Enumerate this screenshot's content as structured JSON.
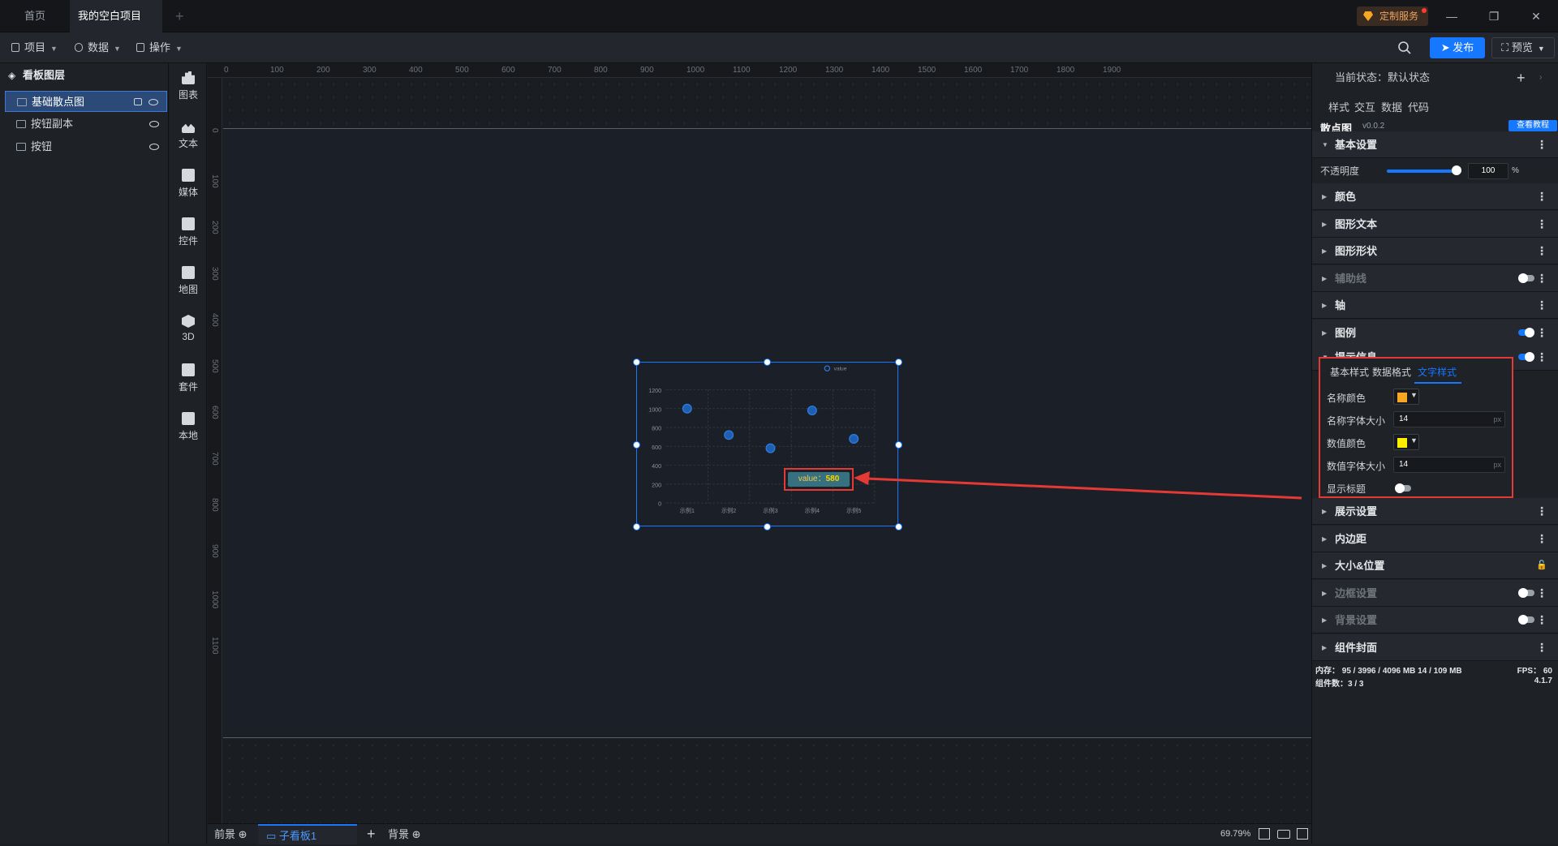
{
  "titlebar": {
    "home_tab": "首页",
    "project_tab": "我的空白项目",
    "add_tab": "+",
    "custom_service": "定制服务",
    "minimize": "—",
    "restore": "❐",
    "close": "✕"
  },
  "menubar": {
    "project": "项目",
    "data": "数据",
    "operate": "操作",
    "publish": "发布",
    "preview": "预览"
  },
  "layers": {
    "title": "看板图层",
    "items": [
      {
        "label": "基础散点图",
        "selected": true
      },
      {
        "label": "按钮副本",
        "selected": false
      },
      {
        "label": "按钮",
        "selected": false
      }
    ]
  },
  "toolbox": {
    "items": [
      {
        "label": "图表",
        "icon": "bar-chart-icon"
      },
      {
        "label": "文本",
        "icon": "text-icon"
      },
      {
        "label": "媒体",
        "icon": "media-icon"
      },
      {
        "label": "控件",
        "icon": "control-icon"
      },
      {
        "label": "地图",
        "icon": "map-icon"
      },
      {
        "label": "3D",
        "icon": "cube-icon"
      },
      {
        "label": "套件",
        "icon": "kit-icon"
      },
      {
        "label": "本地",
        "icon": "puzzle-icon"
      }
    ]
  },
  "ruler": {
    "top": [
      "0",
      "100",
      "200",
      "300",
      "400",
      "500",
      "600",
      "700",
      "800",
      "900",
      "1000",
      "1100",
      "1200",
      "1300",
      "1400",
      "1500",
      "1600",
      "1700",
      "1800",
      "1900"
    ],
    "left": [
      "0",
      "100",
      "200",
      "300",
      "400",
      "500",
      "600",
      "700",
      "800",
      "900",
      "1000",
      "1100"
    ]
  },
  "chart_data": {
    "type": "scatter",
    "title": "",
    "xlabel": "",
    "ylabel": "",
    "categories": [
      "示例1",
      "示例2",
      "示例3",
      "示例4",
      "示例5"
    ],
    "series": [
      {
        "name": "value",
        "values": [
          1000,
          720,
          580,
          980,
          680
        ]
      }
    ],
    "ylim": [
      0,
      1200
    ],
    "yticks": [
      0,
      200,
      400,
      600,
      800,
      1000,
      1200
    ],
    "grid": true,
    "legend_position": "top-right",
    "colors": {
      "point": "#1e5fb3",
      "point_stroke": "#2f7de1",
      "grid": "#3a4049",
      "axis_text": "#8a9099"
    },
    "tooltip": {
      "name": "value：",
      "value": "580",
      "category": "示例3"
    }
  },
  "bottombar": {
    "front": "前景",
    "sub_board": "子看板1",
    "add": "+",
    "background": "背景",
    "zoom": "69.79%"
  },
  "right_panel": {
    "state_label": "当前状态：",
    "state_value": "默认状态",
    "tabs": [
      "样式",
      "交互",
      "数据",
      "代码"
    ],
    "component_name": "散点图",
    "component_version": "v0.0.2",
    "tutorial": "查看教程",
    "basic_settings": "基本设置",
    "opacity_label": "不透明度",
    "opacity_value": "100",
    "opacity_unit": "%",
    "opacity_level": 1.0,
    "sections": [
      {
        "label": "颜色",
        "dim": false,
        "toggle": null
      },
      {
        "label": "图形文本",
        "dim": false,
        "toggle": null
      },
      {
        "label": "图形形状",
        "dim": false,
        "toggle": null
      },
      {
        "label": "辅助线",
        "dim": true,
        "toggle": "off"
      },
      {
        "label": "轴",
        "dim": false,
        "toggle": null
      },
      {
        "label": "图例",
        "dim": false,
        "toggle": "on"
      }
    ],
    "tooltip_section": "提示信息",
    "tooltip_tabs": [
      "基本样式",
      "数据格式",
      "文字样式"
    ],
    "tooltip_fields": {
      "name_color_label": "名称颜色",
      "name_color": "#f5a623",
      "name_size_label": "名称字体大小",
      "name_size": "14",
      "value_color_label": "数值颜色",
      "value_color": "#ffee00",
      "value_size_label": "数值字体大小",
      "value_size": "14",
      "unit": "px",
      "show_title_label": "显示标题"
    },
    "lower_sections": [
      {
        "label": "展示设置",
        "dim": false,
        "toggle": null
      },
      {
        "label": "内边距",
        "dim": false,
        "toggle": null
      },
      {
        "label": "大小&位置",
        "dim": false,
        "toggle": "lock"
      },
      {
        "label": "边框设置",
        "dim": true,
        "toggle": "off"
      },
      {
        "label": "背景设置",
        "dim": true,
        "toggle": "off"
      },
      {
        "label": "组件封面",
        "dim": false,
        "toggle": null
      }
    ],
    "status": {
      "memory": "内存： 95 / 3996 / 4096 MB  14 / 109 MB",
      "fps": "FPS： 60",
      "components": "组件数：3 / 3",
      "version": "4.1.7"
    }
  }
}
